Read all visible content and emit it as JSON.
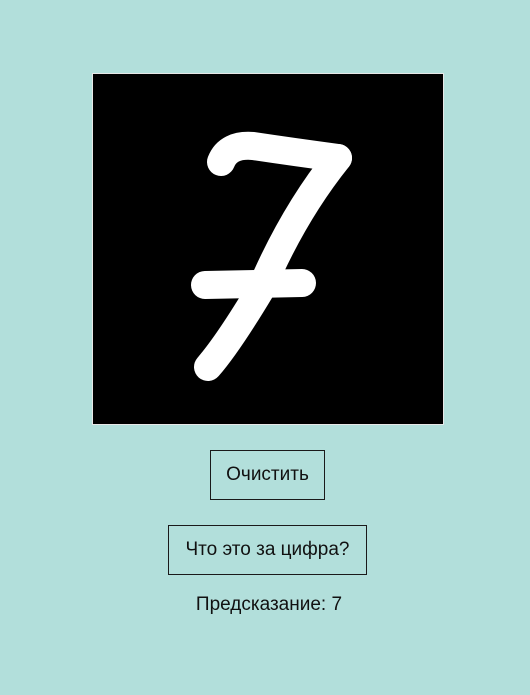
{
  "drawing_canvas": {
    "background": "#000000",
    "stroke_color": "#ffffff"
  },
  "clear_button": {
    "label": "Очистить"
  },
  "predict_button": {
    "label": "Что это за цифра?"
  },
  "prediction": {
    "label": "Предсказание:",
    "value": "7"
  },
  "colors": {
    "page_background": "#b2dfdb"
  }
}
